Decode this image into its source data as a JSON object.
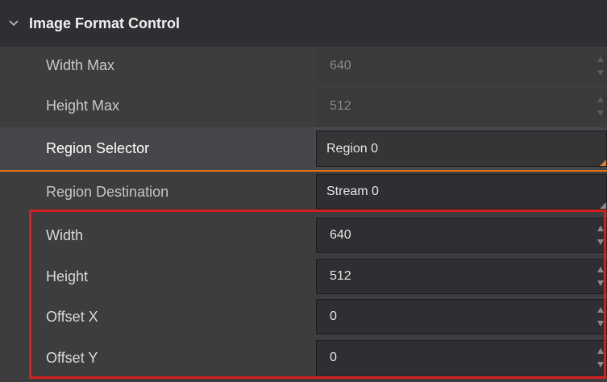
{
  "section": {
    "title": "Image Format Control"
  },
  "rows": [
    {
      "label": "Width Max",
      "value": "640"
    },
    {
      "label": "Height Max",
      "value": "512"
    },
    {
      "label": "Region Selector",
      "value": "Region 0"
    },
    {
      "label": "Region Destination",
      "value": "Stream 0"
    },
    {
      "label": "Width",
      "value": "640"
    },
    {
      "label": "Height",
      "value": "512"
    },
    {
      "label": "Offset X",
      "value": "0"
    },
    {
      "label": "Offset Y",
      "value": "0"
    }
  ],
  "colors": {
    "highlight_frame": "#d61f1f",
    "selection_line": "#e0701a"
  },
  "icons": {
    "section_toggle": "chevron-down-icon",
    "spin": "spin-arrows-icon",
    "dropdown": "dropdown-corner-icon"
  }
}
